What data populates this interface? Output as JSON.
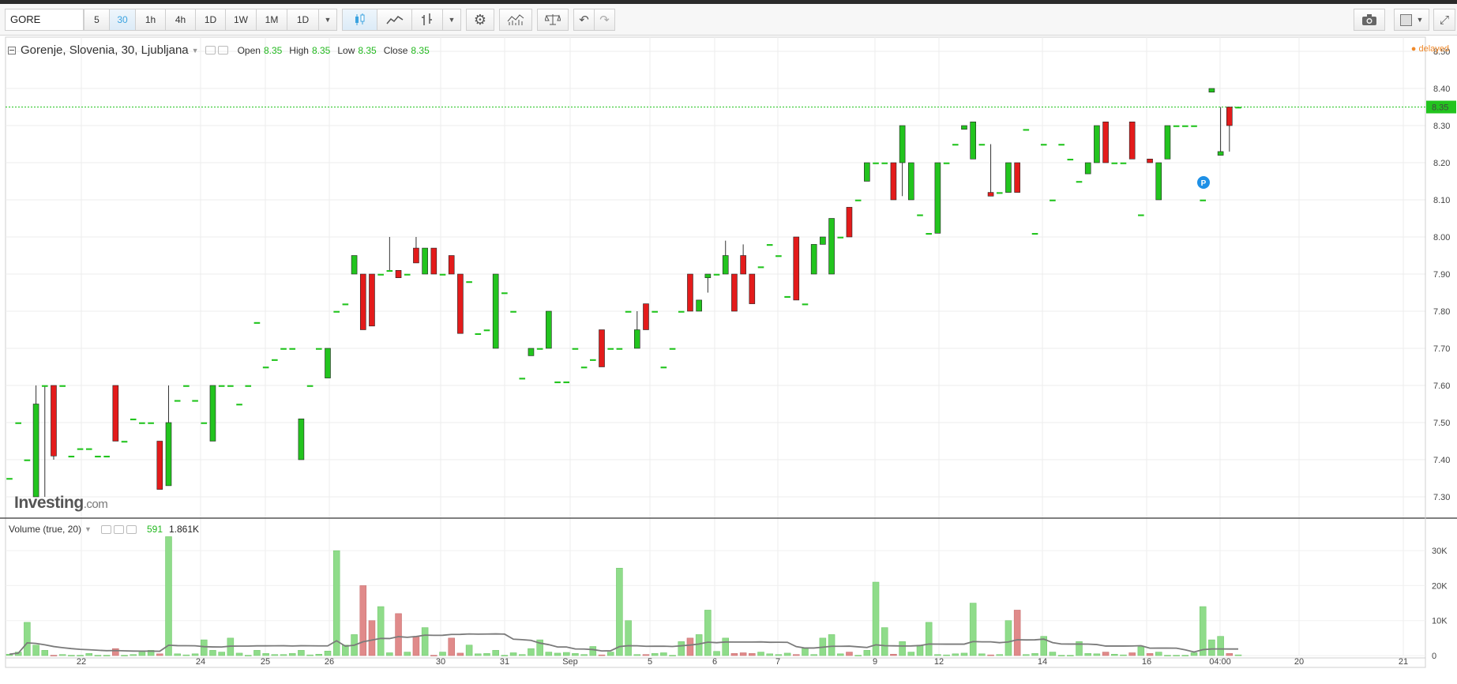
{
  "toolbar": {
    "symbol": "GORE",
    "intervals": [
      "5",
      "30",
      "1h",
      "4h",
      "1D",
      "1W",
      "1M",
      "1D"
    ],
    "selected_interval": "30",
    "icons": [
      "candlestick-icon",
      "line-chart-icon",
      "bar-chart-icon",
      "dropdown-icon",
      "gear-icon",
      "indicators-icon",
      "compare-icon",
      "undo-icon",
      "redo-icon",
      "camera-icon",
      "layout-icon",
      "fullscreen-icon"
    ]
  },
  "legend": {
    "title": "Gorenje, Slovenia, 30, Ljubljana",
    "open_label": "Open",
    "open": "8.35",
    "high_label": "High",
    "high": "8.35",
    "low_label": "Low",
    "low": "8.35",
    "close_label": "Close",
    "close": "8.35"
  },
  "status": {
    "delayed": "delayed"
  },
  "logo": {
    "name": "Investing",
    "suffix": ".com"
  },
  "volume_legend": {
    "title": "Volume (true, 20)",
    "value1": "591",
    "value2": "1.861K"
  },
  "colors": {
    "up": "#22c41e",
    "down": "#e31b1b",
    "vol_up": "#8fdc8a",
    "vol_down": "#e08a8a",
    "last_price": "#22c41e",
    "ma_line": "#7a7a7a"
  },
  "chart_data": {
    "type": "candlestick",
    "price_axis": {
      "labels": [
        "8.50",
        "8.40",
        "8.30",
        "8.20",
        "8.10",
        "8.00",
        "7.90",
        "7.80",
        "7.70",
        "7.60",
        "7.50",
        "7.40",
        "7.30"
      ],
      "ylim": [
        7.25,
        8.52
      ]
    },
    "last_price": "8.35",
    "time_axis": [
      "22",
      "24",
      "25",
      "26",
      "30",
      "31",
      "Sep",
      "5",
      "6",
      "7",
      "9",
      "12",
      "14",
      "16",
      "04:00",
      "20",
      "21"
    ],
    "volume_axis": {
      "labels": [
        "30K",
        "20K",
        "10K",
        "0"
      ],
      "ylim": [
        0,
        35000
      ]
    },
    "candles": [
      [
        7.35,
        7.35,
        7.35,
        7.35
      ],
      [
        7.5,
        7.5,
        7.5,
        7.5
      ],
      [
        7.4,
        7.4,
        7.4,
        7.4
      ],
      [
        7.3,
        7.6,
        7.3,
        7.55
      ],
      [
        7.6,
        7.6,
        7.3,
        7.6
      ],
      [
        7.6,
        7.6,
        7.4,
        7.41
      ],
      [
        7.6,
        7.6,
        7.6,
        7.6
      ],
      [
        7.41,
        7.41,
        7.41,
        7.41
      ],
      [
        7.43,
        7.43,
        7.43,
        7.43
      ],
      [
        7.43,
        7.43,
        7.43,
        7.43
      ],
      [
        7.41,
        7.41,
        7.41,
        7.41
      ],
      [
        7.41,
        7.41,
        7.41,
        7.41
      ],
      [
        7.6,
        7.6,
        7.45,
        7.45
      ],
      [
        7.45,
        7.45,
        7.45,
        7.45
      ],
      [
        7.51,
        7.51,
        7.51,
        7.51
      ],
      [
        7.5,
        7.5,
        7.5,
        7.5
      ],
      [
        7.5,
        7.5,
        7.5,
        7.5
      ],
      [
        7.45,
        7.45,
        7.32,
        7.32
      ],
      [
        7.33,
        7.6,
        7.33,
        7.5
      ],
      [
        7.56,
        7.56,
        7.56,
        7.56
      ],
      [
        7.6,
        7.6,
        7.6,
        7.6
      ],
      [
        7.56,
        7.56,
        7.56,
        7.56
      ],
      [
        7.5,
        7.5,
        7.5,
        7.5
      ],
      [
        7.45,
        7.6,
        7.45,
        7.6
      ],
      [
        7.6,
        7.6,
        7.6,
        7.6
      ],
      [
        7.6,
        7.6,
        7.6,
        7.6
      ],
      [
        7.55,
        7.55,
        7.55,
        7.55
      ],
      [
        7.6,
        7.6,
        7.6,
        7.6
      ],
      [
        7.77,
        7.77,
        7.77,
        7.77
      ],
      [
        7.65,
        7.65,
        7.65,
        7.65
      ],
      [
        7.67,
        7.67,
        7.67,
        7.67
      ],
      [
        7.7,
        7.7,
        7.7,
        7.7
      ],
      [
        7.7,
        7.7,
        7.7,
        7.7
      ],
      [
        7.4,
        7.51,
        7.4,
        7.51
      ],
      [
        7.6,
        7.6,
        7.6,
        7.6
      ],
      [
        7.7,
        7.7,
        7.7,
        7.7
      ],
      [
        7.62,
        7.7,
        7.62,
        7.7
      ],
      [
        7.8,
        7.8,
        7.8,
        7.8
      ],
      [
        7.82,
        7.82,
        7.82,
        7.82
      ],
      [
        7.9,
        7.95,
        7.9,
        7.95
      ],
      [
        7.9,
        7.9,
        7.75,
        7.75
      ],
      [
        7.9,
        7.9,
        7.76,
        7.76
      ],
      [
        7.9,
        7.9,
        7.9,
        7.9
      ],
      [
        7.91,
        8.0,
        7.91,
        7.91
      ],
      [
        7.91,
        7.91,
        7.89,
        7.89
      ],
      [
        7.9,
        7.9,
        7.9,
        7.9
      ],
      [
        7.97,
        8.0,
        7.93,
        7.93
      ],
      [
        7.9,
        7.97,
        7.9,
        7.97
      ],
      [
        7.97,
        7.97,
        7.9,
        7.9
      ],
      [
        7.9,
        7.9,
        7.9,
        7.9
      ],
      [
        7.95,
        7.95,
        7.9,
        7.9
      ],
      [
        7.9,
        7.9,
        7.74,
        7.74
      ],
      [
        7.88,
        7.88,
        7.88,
        7.88
      ],
      [
        7.74,
        7.74,
        7.74,
        7.74
      ],
      [
        7.75,
        7.75,
        7.75,
        7.75
      ],
      [
        7.7,
        7.9,
        7.7,
        7.9
      ],
      [
        7.85,
        7.85,
        7.85,
        7.85
      ],
      [
        7.8,
        7.8,
        7.8,
        7.8
      ],
      [
        7.62,
        7.62,
        7.62,
        7.62
      ],
      [
        7.68,
        7.7,
        7.68,
        7.7
      ],
      [
        7.7,
        7.7,
        7.7,
        7.7
      ],
      [
        7.7,
        7.8,
        7.7,
        7.8
      ],
      [
        7.61,
        7.61,
        7.61,
        7.61
      ],
      [
        7.61,
        7.61,
        7.61,
        7.61
      ],
      [
        7.7,
        7.7,
        7.7,
        7.7
      ],
      [
        7.65,
        7.65,
        7.65,
        7.65
      ],
      [
        7.67,
        7.67,
        7.67,
        7.67
      ],
      [
        7.75,
        7.75,
        7.65,
        7.65
      ],
      [
        7.7,
        7.7,
        7.7,
        7.7
      ],
      [
        7.7,
        7.7,
        7.7,
        7.7
      ],
      [
        7.8,
        7.8,
        7.8,
        7.8
      ],
      [
        7.7,
        7.8,
        7.7,
        7.75
      ],
      [
        7.82,
        7.82,
        7.75,
        7.75
      ],
      [
        7.8,
        7.8,
        7.8,
        7.8
      ],
      [
        7.65,
        7.65,
        7.65,
        7.65
      ],
      [
        7.7,
        7.7,
        7.7,
        7.7
      ],
      [
        7.8,
        7.8,
        7.8,
        7.8
      ],
      [
        7.9,
        7.9,
        7.8,
        7.8
      ],
      [
        7.8,
        7.83,
        7.8,
        7.83
      ],
      [
        7.89,
        7.89,
        7.85,
        7.9
      ],
      [
        7.9,
        7.9,
        7.9,
        7.9
      ],
      [
        7.9,
        7.99,
        7.9,
        7.95
      ],
      [
        7.9,
        7.9,
        7.8,
        7.8
      ],
      [
        7.95,
        7.98,
        7.9,
        7.9
      ],
      [
        7.9,
        7.9,
        7.82,
        7.82
      ],
      [
        7.92,
        7.92,
        7.92,
        7.92
      ],
      [
        7.98,
        7.98,
        7.98,
        7.98
      ],
      [
        7.95,
        7.95,
        7.95,
        7.95
      ],
      [
        7.84,
        7.84,
        7.84,
        7.84
      ],
      [
        8.0,
        8.0,
        7.83,
        7.83
      ],
      [
        7.82,
        7.82,
        7.82,
        7.82
      ],
      [
        7.9,
        7.98,
        7.9,
        7.98
      ],
      [
        7.98,
        8.0,
        7.98,
        8.0
      ],
      [
        7.9,
        8.05,
        7.9,
        8.05
      ],
      [
        8.0,
        8.0,
        8.0,
        8.0
      ],
      [
        8.08,
        8.08,
        8.0,
        8.0
      ],
      [
        8.1,
        8.1,
        8.1,
        8.1
      ],
      [
        8.15,
        8.2,
        8.15,
        8.2
      ],
      [
        8.2,
        8.2,
        8.2,
        8.2
      ],
      [
        8.2,
        8.2,
        8.2,
        8.2
      ],
      [
        8.2,
        8.2,
        8.1,
        8.1
      ],
      [
        8.2,
        8.3,
        8.11,
        8.3
      ],
      [
        8.1,
        8.2,
        8.1,
        8.2
      ],
      [
        8.06,
        8.06,
        8.06,
        8.06
      ],
      [
        8.01,
        8.01,
        8.01,
        8.01
      ],
      [
        8.01,
        8.2,
        8.01,
        8.2
      ],
      [
        8.2,
        8.2,
        8.2,
        8.2
      ],
      [
        8.25,
        8.25,
        8.25,
        8.25
      ],
      [
        8.29,
        8.3,
        8.29,
        8.3
      ],
      [
        8.21,
        8.31,
        8.21,
        8.31
      ],
      [
        8.25,
        8.25,
        8.25,
        8.25
      ],
      [
        8.12,
        8.25,
        8.11,
        8.11
      ],
      [
        8.12,
        8.12,
        8.12,
        8.12
      ],
      [
        8.12,
        8.2,
        8.12,
        8.2
      ],
      [
        8.2,
        8.2,
        8.12,
        8.12
      ],
      [
        8.29,
        8.29,
        8.29,
        8.29
      ],
      [
        8.01,
        8.01,
        8.01,
        8.01
      ],
      [
        8.25,
        8.25,
        8.25,
        8.25
      ],
      [
        8.1,
        8.1,
        8.1,
        8.1
      ],
      [
        8.25,
        8.25,
        8.25,
        8.25
      ],
      [
        8.21,
        8.21,
        8.21,
        8.21
      ],
      [
        8.15,
        8.15,
        8.15,
        8.15
      ],
      [
        8.17,
        8.2,
        8.17,
        8.2
      ],
      [
        8.2,
        8.3,
        8.2,
        8.3
      ],
      [
        8.31,
        8.31,
        8.2,
        8.2
      ],
      [
        8.2,
        8.2,
        8.2,
        8.2
      ],
      [
        8.2,
        8.2,
        8.2,
        8.2
      ],
      [
        8.31,
        8.31,
        8.21,
        8.21
      ],
      [
        8.06,
        8.06,
        8.06,
        8.06
      ],
      [
        8.21,
        8.21,
        8.2,
        8.2
      ],
      [
        8.1,
        8.2,
        8.1,
        8.2
      ],
      [
        8.21,
        8.3,
        8.21,
        8.3
      ],
      [
        8.3,
        8.3,
        8.3,
        8.3
      ],
      [
        8.3,
        8.3,
        8.3,
        8.3
      ],
      [
        8.3,
        8.3,
        8.3,
        8.3
      ],
      [
        8.1,
        8.1,
        8.1,
        8.1
      ],
      [
        8.39,
        8.4,
        8.39,
        8.4
      ],
      [
        8.22,
        8.35,
        8.22,
        8.23
      ],
      [
        8.35,
        8.35,
        8.23,
        8.3
      ],
      [
        8.35,
        8.35,
        8.35,
        8.35
      ]
    ],
    "volumes": [
      400,
      1000,
      9500,
      3000,
      1500,
      100,
      300,
      100,
      100,
      600,
      100,
      100,
      2000,
      100,
      300,
      1000,
      1500,
      500,
      34000,
      500,
      200,
      500,
      4500,
      1500,
      1000,
      5000,
      700,
      100,
      1500,
      600,
      300,
      300,
      600,
      1500,
      200,
      400,
      1300,
      30000,
      3000,
      6000,
      20000,
      10000,
      14000,
      800,
      12000,
      1000,
      5500,
      8000,
      100,
      1000,
      5000,
      700,
      3000,
      500,
      600,
      1500,
      100,
      800,
      300,
      2000,
      4500,
      1000,
      700,
      900,
      600,
      300,
      2600,
      200,
      1000,
      25000,
      10000,
      300,
      300,
      600,
      800,
      100,
      4000,
      5000,
      6000,
      13000,
      1200,
      5000,
      600,
      800,
      600,
      1000,
      500,
      300,
      700,
      300,
      2000,
      300,
      5000,
      6000,
      500,
      1000,
      100,
      1500,
      21000,
      8000,
      400,
      4000,
      1000,
      3000,
      9500,
      300,
      200,
      500,
      700,
      15000,
      500,
      200,
      300,
      10000,
      13000,
      300,
      600,
      5500,
      1000,
      100,
      100,
      4000,
      600,
      500,
      1000,
      400,
      200,
      800,
      2500,
      600,
      1000,
      100,
      100,
      100,
      800,
      14000,
      4500,
      5500,
      600,
      200
    ]
  }
}
